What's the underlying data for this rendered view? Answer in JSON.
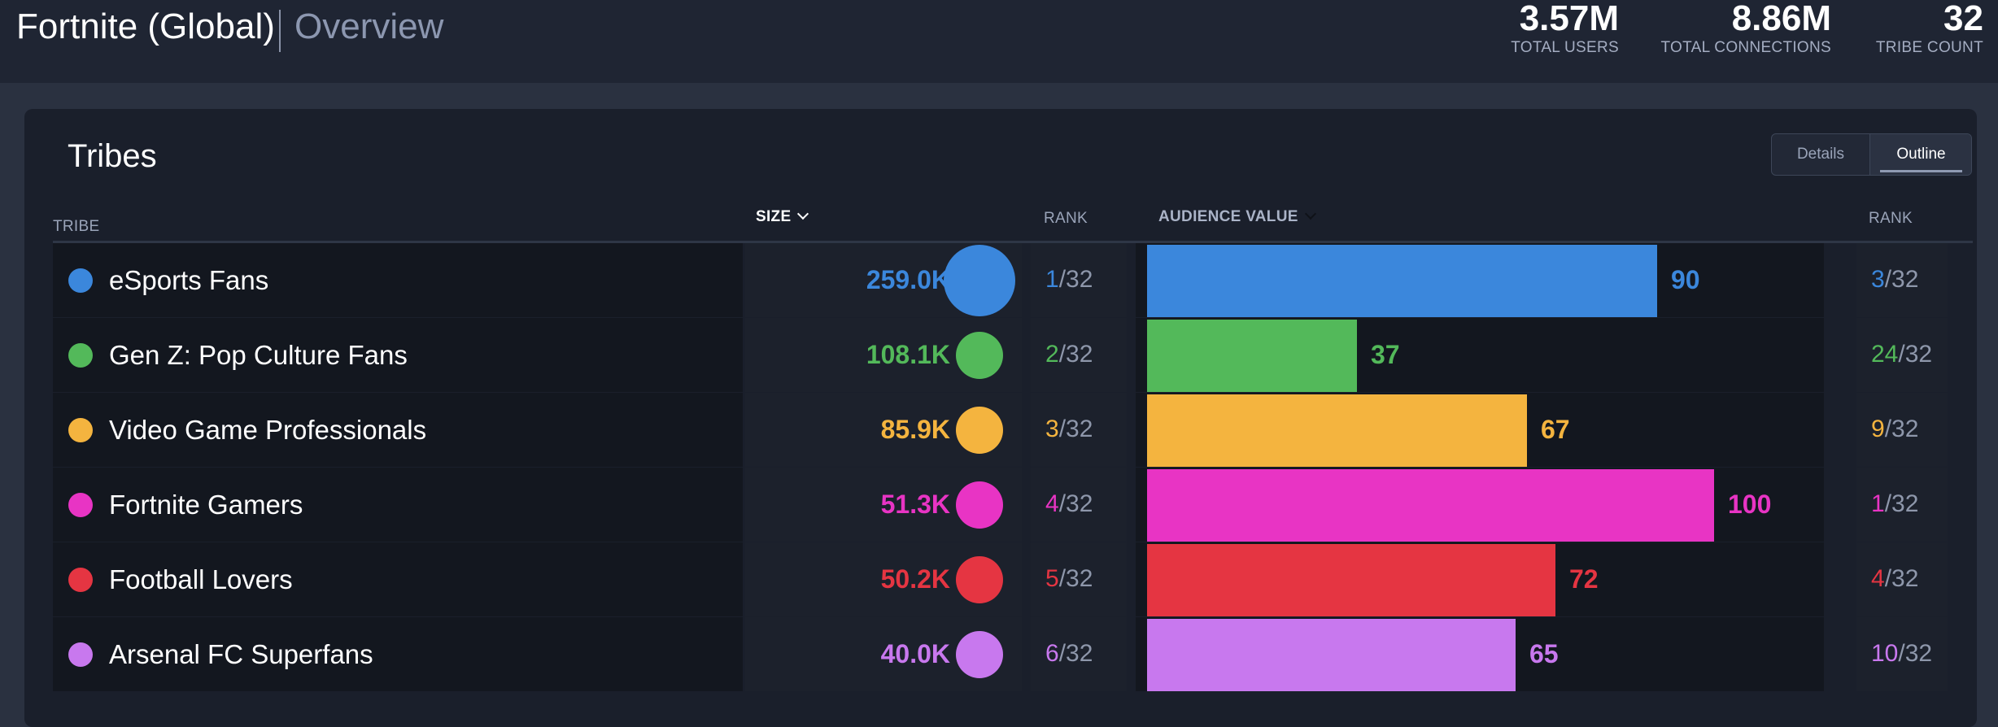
{
  "header": {
    "title": "Fortnite (Global)",
    "subtitle": "Overview",
    "stats": [
      {
        "value": "3.57M",
        "label": "TOTAL USERS"
      },
      {
        "value": "8.86M",
        "label": "TOTAL CONNECTIONS"
      },
      {
        "value": "32",
        "label": "TRIBE COUNT"
      }
    ]
  },
  "panel": {
    "title": "Tribes",
    "toggle": {
      "details": "Details",
      "outline": "Outline",
      "active": "Outline"
    }
  },
  "columns": {
    "tribe": "TRIBE",
    "size": "SIZE",
    "rank": "RANK",
    "audience_value": "AUDIENCE VALUE",
    "rank2": "RANK"
  },
  "rank_total": "/32",
  "rows": [
    {
      "name": "eSports Fans",
      "color": "#3b87dc",
      "size": "259.0K",
      "size_k": 259.0,
      "rank": "1",
      "audience_value": 90,
      "av_rank": "3"
    },
    {
      "name": "Gen Z: Pop Culture Fans",
      "color": "#53b95a",
      "size": "108.1K",
      "size_k": 108.1,
      "rank": "2",
      "audience_value": 37,
      "av_rank": "24"
    },
    {
      "name": "Video Game Professionals",
      "color": "#f4b43f",
      "size": "85.9K",
      "size_k": 85.9,
      "rank": "3",
      "audience_value": 67,
      "av_rank": "9"
    },
    {
      "name": "Fortnite Gamers",
      "color": "#e834c4",
      "size": "51.3K",
      "size_k": 51.3,
      "rank": "4",
      "audience_value": 100,
      "av_rank": "1"
    },
    {
      "name": "Football Lovers",
      "color": "#e53542",
      "size": "50.2K",
      "size_k": 50.2,
      "rank": "5",
      "audience_value": 72,
      "av_rank": "4"
    },
    {
      "name": "Arsenal FC Superfans",
      "color": "#c878ee",
      "size": "40.0K",
      "size_k": 40.0,
      "rank": "6",
      "audience_value": 65,
      "av_rank": "10"
    }
  ]
}
